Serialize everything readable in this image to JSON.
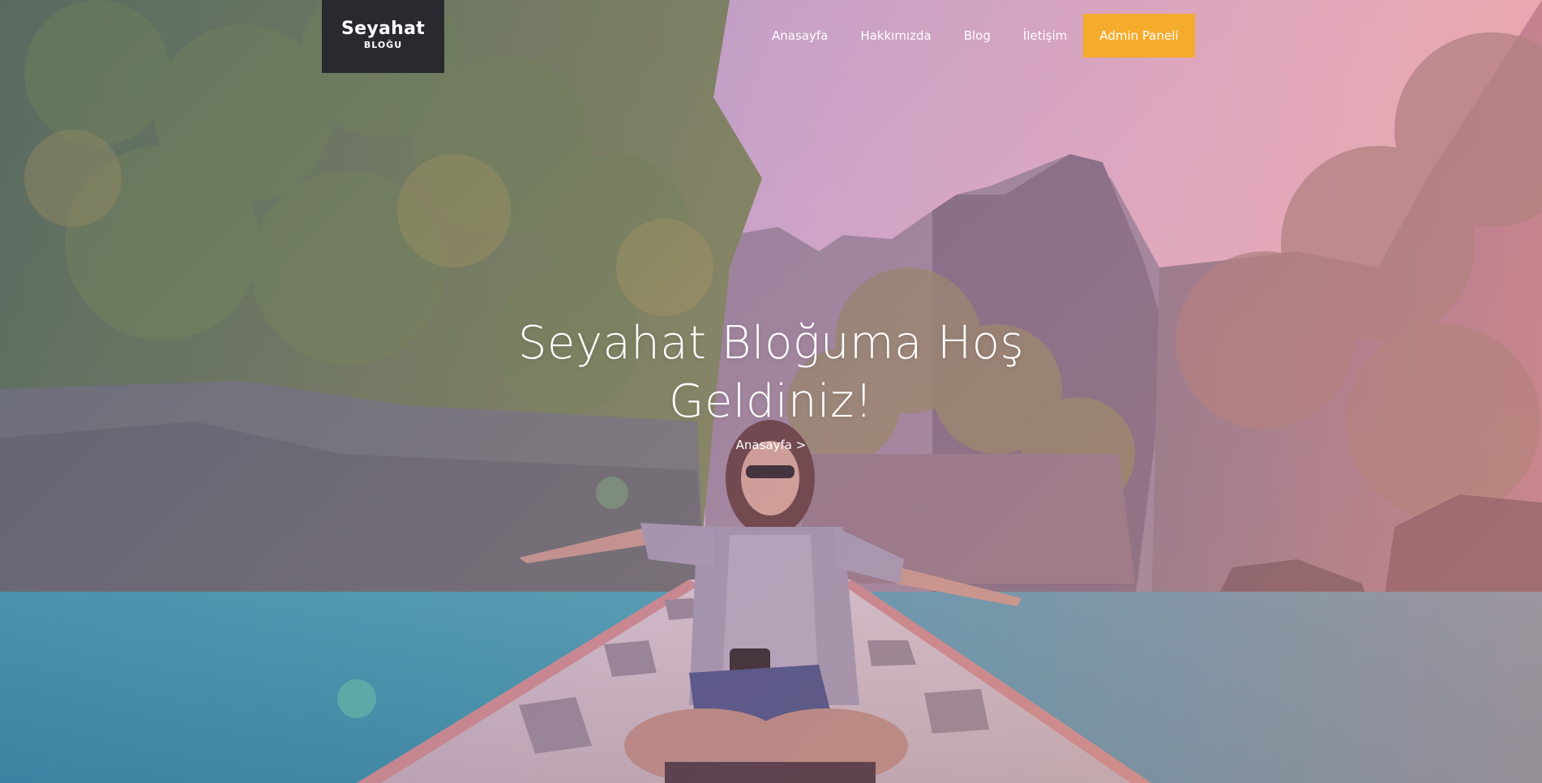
{
  "logo": {
    "title": "Seyahat",
    "subtitle": "BLOĞU"
  },
  "nav": {
    "items": [
      {
        "label": "Anasayfa"
      },
      {
        "label": "Hakkımızda"
      },
      {
        "label": "Blog"
      },
      {
        "label": "İletişim"
      }
    ],
    "admin_label": "Admin Paneli"
  },
  "hero": {
    "title_line1": "Seyahat Bloğuma Hoş",
    "title_line2": "Geldiniz!",
    "breadcrumb_label": "Anasayfa",
    "breadcrumb_separator": ">"
  },
  "colors": {
    "logo_bg": "#2a2930",
    "admin_button": "#f5ab2b",
    "text": "#ffffff"
  }
}
